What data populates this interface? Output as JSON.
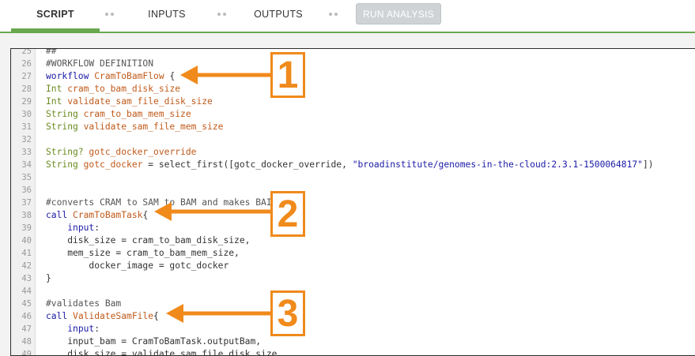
{
  "tabs": [
    {
      "label": "SCRIPT",
      "active": true
    },
    {
      "label": "INPUTS",
      "active": false
    },
    {
      "label": "OUTPUTS",
      "active": false
    }
  ],
  "run_button": {
    "label": "RUN ANALYSIS",
    "enabled": false
  },
  "accent_color": "#6aa84f",
  "annotation_color": "#f08a1b",
  "code_lines": [
    {
      "num": "25",
      "tokens": [
        {
          "t": "##",
          "c": "cm"
        }
      ]
    },
    {
      "num": "26",
      "tokens": [
        {
          "t": "#WORKFLOW DEFINITION",
          "c": "cm"
        }
      ]
    },
    {
      "num": "27",
      "tokens": [
        {
          "t": "workflow ",
          "c": "kw"
        },
        {
          "t": "CramToBamFlow",
          "c": "id"
        },
        {
          "t": " {",
          "c": ""
        }
      ]
    },
    {
      "num": "28",
      "tokens": [
        {
          "t": "Int ",
          "c": "ty"
        },
        {
          "t": "cram_to_bam_disk_size",
          "c": "id"
        }
      ]
    },
    {
      "num": "29",
      "tokens": [
        {
          "t": "Int ",
          "c": "ty"
        },
        {
          "t": "validate_sam_file_disk_size",
          "c": "id"
        }
      ]
    },
    {
      "num": "30",
      "tokens": [
        {
          "t": "String ",
          "c": "ty"
        },
        {
          "t": "cram_to_bam_mem_size",
          "c": "id"
        }
      ]
    },
    {
      "num": "31",
      "tokens": [
        {
          "t": "String ",
          "c": "ty"
        },
        {
          "t": "validate_sam_file_mem_size",
          "c": "id"
        }
      ]
    },
    {
      "num": "32",
      "tokens": []
    },
    {
      "num": "33",
      "tokens": [
        {
          "t": "String? ",
          "c": "ty"
        },
        {
          "t": "gotc_docker_override",
          "c": "id"
        }
      ]
    },
    {
      "num": "34",
      "tokens": [
        {
          "t": "String ",
          "c": "ty"
        },
        {
          "t": "gotc_docker",
          "c": "id"
        },
        {
          "t": " = select_first([gotc_docker_override, ",
          "c": ""
        },
        {
          "t": "\"broadinstitute/genomes-in-the-cloud:2.3.1-1500064817\"",
          "c": "str"
        },
        {
          "t": "])",
          "c": ""
        }
      ]
    },
    {
      "num": "35",
      "tokens": []
    },
    {
      "num": "36",
      "tokens": []
    },
    {
      "num": "37",
      "tokens": [
        {
          "t": "#converts CRAM to SAM to BAM and makes BAI",
          "c": "cm"
        }
      ]
    },
    {
      "num": "38",
      "tokens": [
        {
          "t": "call ",
          "c": "kw"
        },
        {
          "t": "CramToBamTask",
          "c": "id"
        },
        {
          "t": "{",
          "c": ""
        }
      ]
    },
    {
      "num": "39",
      "tokens": [
        {
          "t": "    ",
          "c": ""
        },
        {
          "t": "input",
          "c": "kw"
        },
        {
          "t": ":",
          "c": ""
        }
      ]
    },
    {
      "num": "40",
      "tokens": [
        {
          "t": "    disk_size = cram_to_bam_disk_size,",
          "c": ""
        }
      ]
    },
    {
      "num": "41",
      "tokens": [
        {
          "t": "    mem_size = cram_to_bam_mem_size,",
          "c": ""
        }
      ]
    },
    {
      "num": "42",
      "tokens": [
        {
          "t": "        docker_image = gotc_docker",
          "c": ""
        }
      ]
    },
    {
      "num": "43",
      "tokens": [
        {
          "t": "}",
          "c": ""
        }
      ]
    },
    {
      "num": "44",
      "tokens": []
    },
    {
      "num": "45",
      "tokens": [
        {
          "t": "#validates Bam",
          "c": "cm"
        }
      ]
    },
    {
      "num": "46",
      "tokens": [
        {
          "t": "call ",
          "c": "kw"
        },
        {
          "t": "ValidateSamFile",
          "c": "id"
        },
        {
          "t": "{",
          "c": ""
        }
      ]
    },
    {
      "num": "47",
      "tokens": [
        {
          "t": "    ",
          "c": ""
        },
        {
          "t": "input",
          "c": "kw"
        },
        {
          "t": ":",
          "c": ""
        }
      ]
    },
    {
      "num": "48",
      "tokens": [
        {
          "t": "    input_bam = CramToBamTask.outputBam,",
          "c": ""
        }
      ]
    },
    {
      "num": "49",
      "tokens": [
        {
          "t": "    disk_size = validate_sam_file_disk_size,",
          "c": ""
        }
      ]
    }
  ],
  "callouts": [
    {
      "label": "1"
    },
    {
      "label": "2"
    },
    {
      "label": "3"
    }
  ]
}
